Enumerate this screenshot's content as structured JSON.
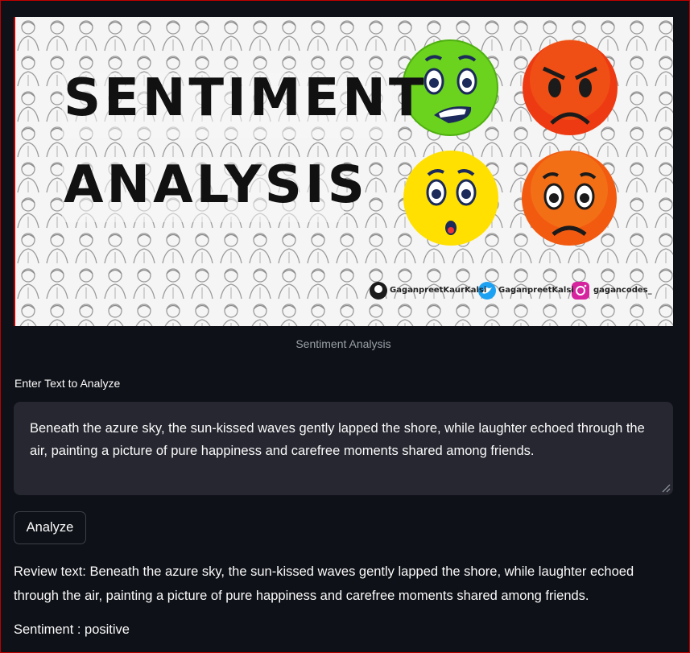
{
  "banner": {
    "title_line1": "SENTIMENT",
    "title_line2": "ANALYSIS",
    "socials": [
      {
        "icon": "github-icon",
        "handle": "GaganpreetKaurKalsi"
      },
      {
        "icon": "twitter-icon",
        "handle": "GaganpreetKalsi"
      },
      {
        "icon": "instagram-icon",
        "handle": "gagancodes_"
      }
    ]
  },
  "image_caption": "Sentiment Analysis",
  "input": {
    "label": "Enter Text to Analyze",
    "value": "Beneath the azure sky, the sun-kissed waves gently lapped the shore, while laughter echoed through the air, painting a picture of pure happiness and carefree moments shared among friends."
  },
  "analyze_button": "Analyze",
  "result": {
    "review_text": "Review text: Beneath the azure sky, the sun-kissed waves gently lapped the shore, while laughter echoed through the air, painting a picture of pure happiness and carefree moments shared among friends.",
    "sentiment": "Sentiment : positive"
  },
  "colors": {
    "background": "#0e1117",
    "input_bg": "#262730",
    "accent_border": "#c00000"
  }
}
